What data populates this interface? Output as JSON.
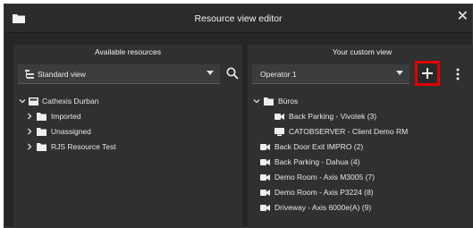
{
  "window": {
    "title": "Resource view editor"
  },
  "left": {
    "heading": "Available resources",
    "view_select": {
      "value": "Standard view"
    },
    "tree": [
      {
        "label": "Cathexis Durban",
        "chevron": "chevron-down-icon",
        "icon": "server-icon"
      },
      {
        "label": "Imported",
        "chevron": "chevron-right-icon",
        "icon": "folder-icon"
      },
      {
        "label": "Unassigned",
        "chevron": "chevron-right-icon",
        "icon": "folder-icon"
      },
      {
        "label": "RJS Resource Test",
        "chevron": "chevron-right-icon",
        "icon": "folder-icon"
      }
    ]
  },
  "right": {
    "heading": "Your custom view",
    "operator_select": {
      "value": "Operator 1"
    },
    "tree": [
      {
        "label": "Büros",
        "chevron": "chevron-down-icon",
        "icon": "folder-icon"
      },
      {
        "label": "Back Parking - Vivotek (3)",
        "icon": "camera-icon"
      },
      {
        "label": "CATOBSERVER - Client Demo RM",
        "icon": "monitor-icon"
      },
      {
        "label": "Back Door Exit IMPRO (2)",
        "icon": "camera-icon"
      },
      {
        "label": "Back Parking - Dahua (4)",
        "icon": "camera-icon"
      },
      {
        "label": "Demo Room - Axis M3005 (7)",
        "icon": "camera-icon"
      },
      {
        "label": "Demo Room - Axis P3224 (8)",
        "icon": "camera-icon"
      },
      {
        "label": "Driveway - Axis 6000e(A) (9)",
        "icon": "camera-icon"
      }
    ]
  },
  "colors": {
    "highlight": "#e00000",
    "background": "#262626",
    "panel": "#303030"
  }
}
